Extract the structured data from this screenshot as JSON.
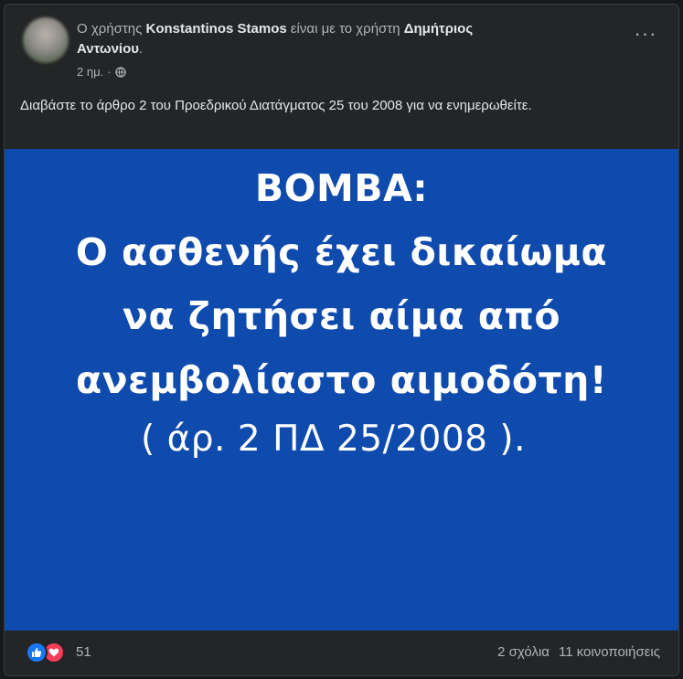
{
  "post": {
    "author_prefix": "Ο χρήστης",
    "author_name": "Konstantinos Stamos",
    "with_text": "είναι με το χρήστη",
    "tagged_name_line1": "Δημήτριος",
    "tagged_name_line2": "Αντωνίου",
    "period": ".",
    "time": "2 ημ.",
    "separator": "·",
    "privacy_icon": "globe-icon",
    "more_label": "···",
    "caption": "Διαβάστε το άρθρο 2 του Προεδρικού Διατάγματος 25 του 2008 για να ενημερωθείτε."
  },
  "image": {
    "background_color": "#0f4aad",
    "lines": [
      "ΒΟΜΒΑ:",
      "Ο ασθενής έχει δικαίωμα",
      "να ζητήσει αίμα από",
      "ανεμβολίαστο αιμοδότη!",
      "( άρ. 2 ΠΔ 25/2008 )."
    ]
  },
  "footer": {
    "reaction_icons": [
      "like-icon",
      "love-icon"
    ],
    "reaction_count": "51",
    "comments": "2 σχόλια",
    "shares": "11 κοινοποιήσεις"
  },
  "colors": {
    "background": "#18191a",
    "card": "#242526",
    "text_primary": "#e4e6eb",
    "text_secondary": "#b0b3b8",
    "like": "#1877f2",
    "love": "#f33e58"
  }
}
